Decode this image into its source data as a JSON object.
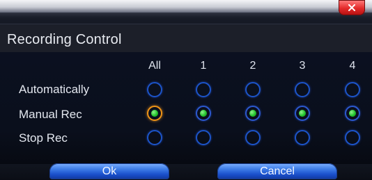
{
  "dialog": {
    "title": "Recording Control",
    "close_icon": "close-icon"
  },
  "columns": [
    "All",
    "1",
    "2",
    "3",
    "4"
  ],
  "rows": [
    {
      "label": "Automatically",
      "selected": [
        false,
        false,
        false,
        false,
        false
      ]
    },
    {
      "label": "Manual Rec",
      "selected": [
        true,
        true,
        true,
        true,
        true
      ]
    },
    {
      "label": "Stop Rec",
      "selected": [
        false,
        false,
        false,
        false,
        false
      ]
    }
  ],
  "buttons": {
    "ok": "Ok",
    "cancel": "Cancel"
  },
  "colors": {
    "radio_ring": "#1c54c9",
    "all_selected_ring": "#f09416",
    "selected_dot": "#24c42d",
    "close_button": "#e32a2a",
    "button_blue": "#3f7fe8"
  }
}
